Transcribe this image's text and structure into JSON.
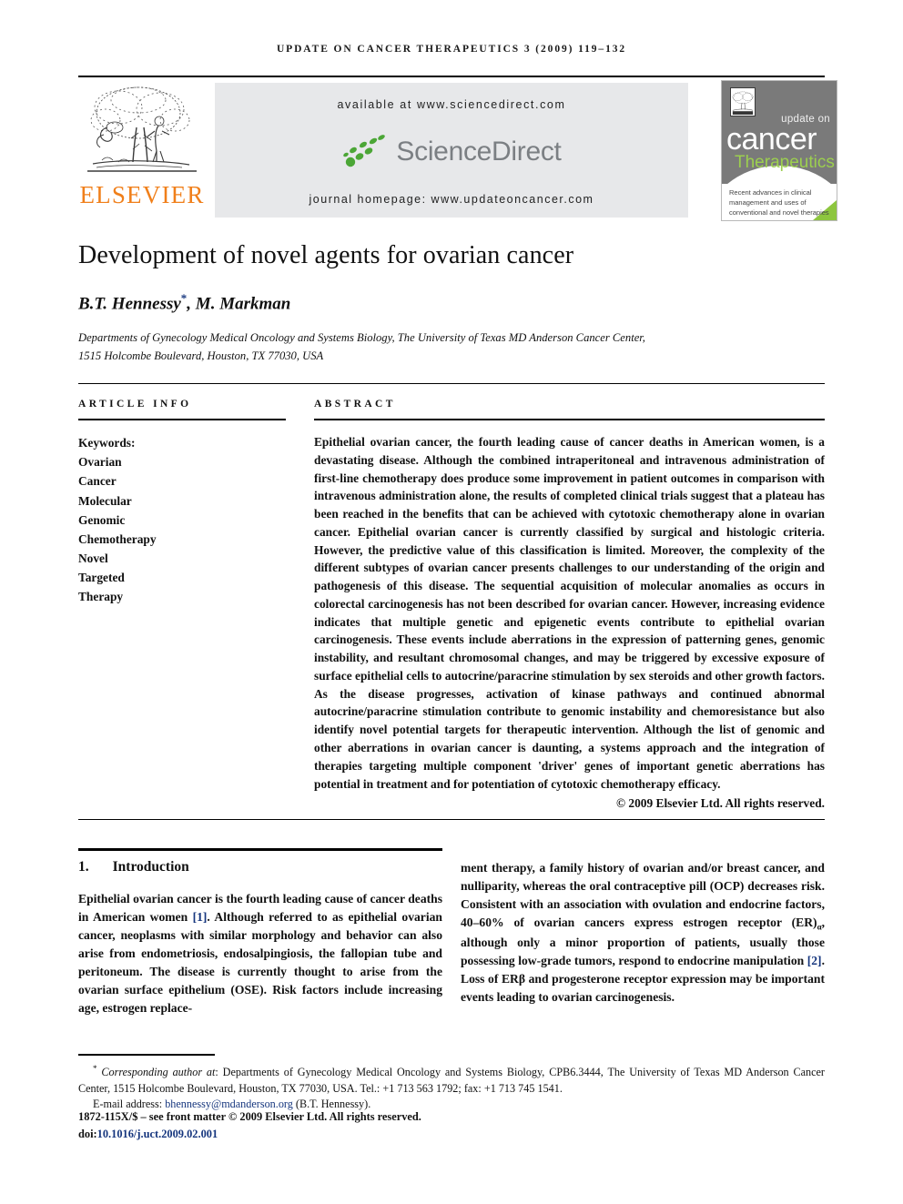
{
  "running_head": "Update on Cancer Therapeutics 3 (2009) 119–132",
  "masthead": {
    "publisher_name": "ELSEVIER",
    "available_at": "available at www.sciencedirect.com",
    "sciencedirect_logo_text": "ScienceDirect",
    "journal_homepage": "journal homepage: www.updateoncancer.com",
    "cover": {
      "line1": "update on",
      "line2": "cancer",
      "line3": "Therapeutics",
      "tagline": "Recent advances in clinical management and uses of conventional and novel therapies"
    },
    "colors": {
      "elsevier_orange": "#F07F1A",
      "sciencedirect_green": "#4BA636",
      "sciencedirect_gray": "#7b7f83",
      "banner_gray": "#e7e8ea",
      "cover_gray": "#7a7a7a",
      "cover_green": "#8DC63F",
      "link_blue": "#16367e"
    }
  },
  "article": {
    "title": "Development of novel agents for ovarian cancer",
    "authors": "B.T. Hennessy",
    "authors_rest": ", M. Markman",
    "corresponding_marker": "*",
    "affiliation_line1": "Departments of Gynecology Medical Oncology and Systems Biology, The University of Texas MD Anderson Cancer Center,",
    "affiliation_line2": "1515 Holcombe Boulevard, Houston, TX 77030, USA"
  },
  "article_info": {
    "heading": "ARTICLE INFO",
    "keywords_label": "Keywords:",
    "keywords": [
      "Ovarian",
      "Cancer",
      "Molecular",
      "Genomic",
      "Chemotherapy",
      "Novel",
      "Targeted",
      "Therapy"
    ]
  },
  "abstract": {
    "heading": "ABSTRACT",
    "text": "Epithelial ovarian cancer, the fourth leading cause of cancer deaths in American women, is a devastating disease. Although the combined intraperitoneal and intravenous administration of first-line chemotherapy does produce some improvement in patient outcomes in comparison with intravenous administration alone, the results of completed clinical trials suggest that a plateau has been reached in the benefits that can be achieved with cytotoxic chemotherapy alone in ovarian cancer. Epithelial ovarian cancer is currently classified by surgical and histologic criteria. However, the predictive value of this classification is limited. Moreover, the complexity of the different subtypes of ovarian cancer presents challenges to our understanding of the origin and pathogenesis of this disease. The sequential acquisition of molecular anomalies as occurs in colorectal carcinogenesis has not been described for ovarian cancer. However, increasing evidence indicates that multiple genetic and epigenetic events contribute to epithelial ovarian carcinogenesis. These events include aberrations in the expression of patterning genes, genomic instability, and resultant chromosomal changes, and may be triggered by excessive exposure of surface epithelial cells to autocrine/paracrine stimulation by sex steroids and other growth factors. As the disease progresses, activation of kinase pathways and continued abnormal autocrine/paracrine stimulation contribute to genomic instability and chemoresistance but also identify novel potential targets for therapeutic intervention. Although the list of genomic and other aberrations in ovarian cancer is daunting, a systems approach and the integration of therapies targeting multiple component 'driver' genes of important genetic aberrations has potential in treatment and for potentiation of cytotoxic chemotherapy efficacy.",
    "copyright": "© 2009 Elsevier Ltd. All rights reserved."
  },
  "body": {
    "section_number": "1.",
    "section_title": "Introduction",
    "left_col_part1": "Epithelial ovarian cancer is the fourth leading cause of cancer deaths in American women ",
    "left_ref1": "[1]",
    "left_col_part2": ". Although referred to as epithelial ovarian cancer, neoplasms with similar morphology and behavior can also arise from endometriosis, endosalpingiosis, the fallopian tube and peritoneum. The disease is currently thought to arise from the ovarian surface epithelium (OSE). Risk factors include increasing age, estrogen replace-",
    "right_col_part1": "ment therapy, a family history of ovarian and/or breast cancer, and nulliparity, whereas the oral contraceptive pill (OCP) decreases risk. Consistent with an association with ovulation and endocrine factors, 40–60% of ovarian cancers express estrogen receptor (ER)",
    "right_subscript": "α",
    "right_col_part2": ", although only a minor proportion of patients, usually those possessing low-grade tumors, respond to endocrine manipulation ",
    "right_ref2": "[2]",
    "right_col_part3": ". Loss of ERβ and progesterone receptor expression may be important events leading to ovarian carcinogenesis."
  },
  "footnote": {
    "star": "*",
    "corresponding_label": "Corresponding author at",
    "corresponding_text": ": Departments of Gynecology Medical Oncology and Systems Biology, CPB6.3444, The University of Texas MD Anderson Cancer Center, 1515 Holcombe Boulevard, Houston, TX 77030, USA. Tel.: +1 713 563 1792; fax: +1 713 745 1541.",
    "email_label": "E-mail address:",
    "email": "bhennessy@mdanderson.org",
    "email_suffix": "(B.T. Hennessy).",
    "issn_line": "1872-115X/$ – see front matter © 2009 Elsevier Ltd. All rights reserved.",
    "doi_prefix": "doi:",
    "doi": "10.1016/j.uct.2009.02.001"
  }
}
